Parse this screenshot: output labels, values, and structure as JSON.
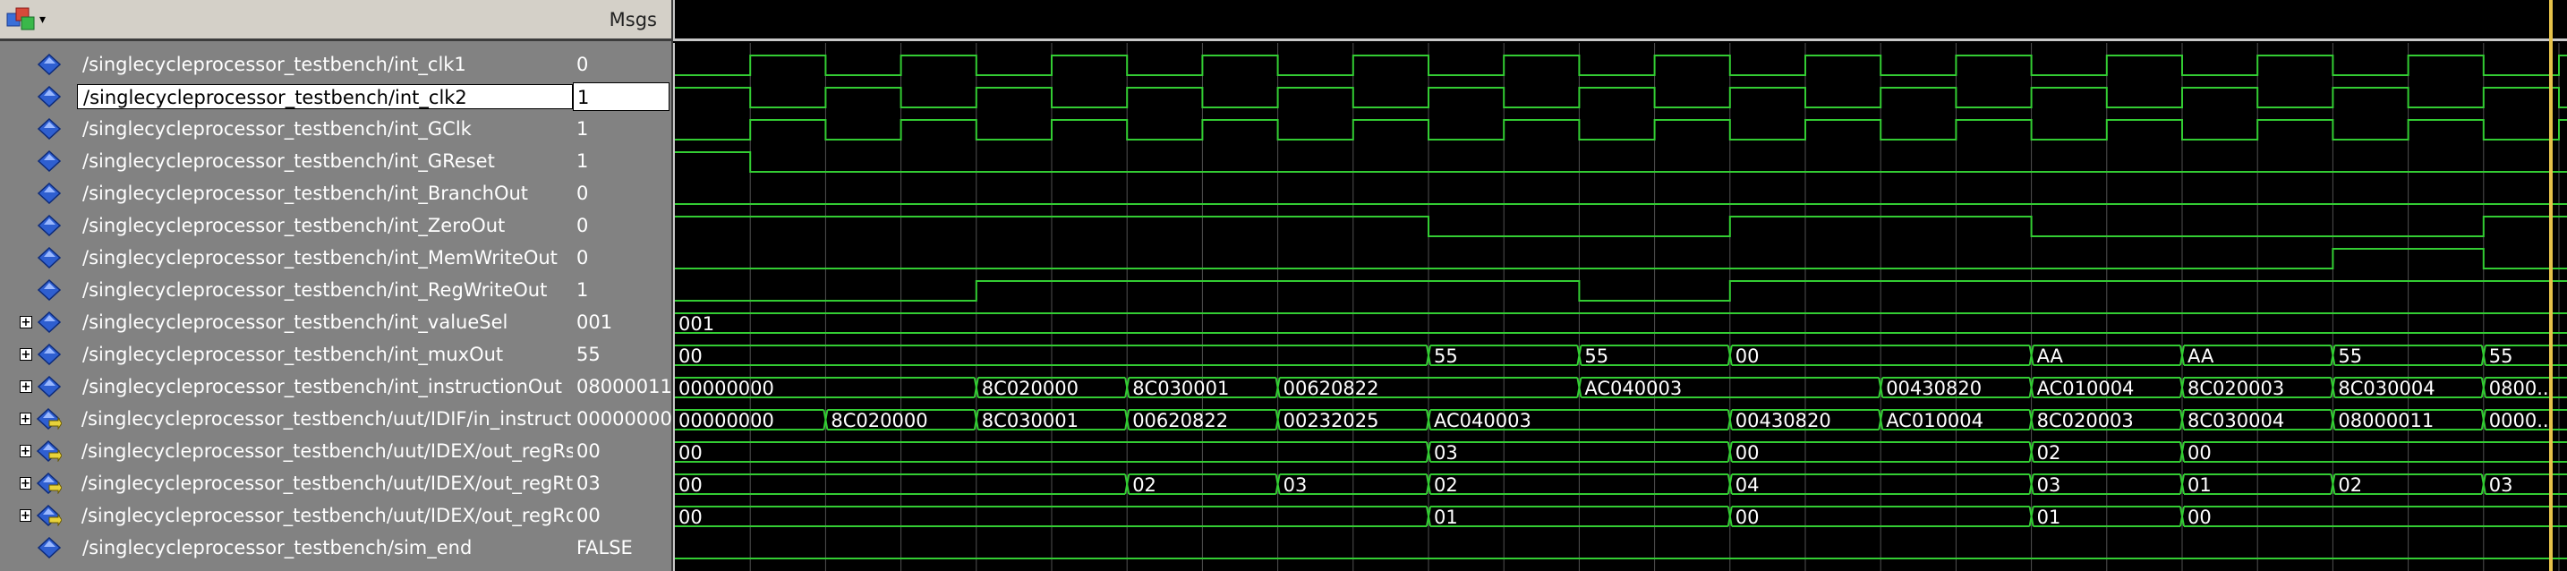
{
  "toolbar": {
    "icon": "wave-tool-icon",
    "dropdown": "▾"
  },
  "header": {
    "msgs_label": "Msgs"
  },
  "colors": {
    "wave": "#33cc33",
    "cursor": "#e6c24a",
    "grid": "#505050",
    "text": "#ffffff"
  },
  "signals": [
    {
      "name": "/singlecycleprocessor_testbench/int_clk1",
      "value": "0",
      "expandable": false,
      "kind": "input"
    },
    {
      "name": "/singlecycleprocessor_testbench/int_clk2",
      "value": "1",
      "expandable": false,
      "kind": "input",
      "selected": true
    },
    {
      "name": "/singlecycleprocessor_testbench/int_GClk",
      "value": "1",
      "expandable": false,
      "kind": "input"
    },
    {
      "name": "/singlecycleprocessor_testbench/int_GReset",
      "value": "1",
      "expandable": false,
      "kind": "input"
    },
    {
      "name": "/singlecycleprocessor_testbench/int_BranchOut",
      "value": "0",
      "expandable": false,
      "kind": "input"
    },
    {
      "name": "/singlecycleprocessor_testbench/int_ZeroOut",
      "value": "0",
      "expandable": false,
      "kind": "input"
    },
    {
      "name": "/singlecycleprocessor_testbench/int_MemWriteOut",
      "value": "0",
      "expandable": false,
      "kind": "input"
    },
    {
      "name": "/singlecycleprocessor_testbench/int_RegWriteOut",
      "value": "1",
      "expandable": false,
      "kind": "input"
    },
    {
      "name": "/singlecycleprocessor_testbench/int_valueSel",
      "value": "001",
      "expandable": true,
      "kind": "input"
    },
    {
      "name": "/singlecycleprocessor_testbench/int_muxOut",
      "value": "55",
      "expandable": true,
      "kind": "input"
    },
    {
      "name": "/singlecycleprocessor_testbench/int_instructionOut",
      "value": "08000011",
      "expandable": true,
      "kind": "input"
    },
    {
      "name": "/singlecycleprocessor_testbench/uut/IDIF/in_instruction",
      "value": "00000000",
      "expandable": true,
      "kind": "port"
    },
    {
      "name": "/singlecycleprocessor_testbench/uut/IDEX/out_regRs",
      "value": "00",
      "expandable": true,
      "kind": "port"
    },
    {
      "name": "/singlecycleprocessor_testbench/uut/IDEX/out_regRt",
      "value": "03",
      "expandable": true,
      "kind": "port"
    },
    {
      "name": "/singlecycleprocessor_testbench/uut/IDEX/out_regRd",
      "value": "00",
      "expandable": true,
      "kind": "port"
    },
    {
      "name": "/singlecycleprocessor_testbench/sim_end",
      "value": "FALSE",
      "expandable": false,
      "kind": "input"
    }
  ],
  "waves": {
    "digital": [
      {
        "levels": [
          0,
          1,
          0,
          1,
          0,
          1,
          0,
          1,
          0,
          1,
          0,
          1,
          0,
          1,
          0,
          1,
          0,
          1,
          0,
          1,
          0,
          1,
          0,
          1,
          0,
          1
        ]
      },
      {
        "levels": [
          1,
          0,
          1,
          0,
          1,
          0,
          1,
          0,
          1,
          0,
          1,
          0,
          1,
          0,
          1,
          0,
          1,
          0,
          1,
          0,
          1,
          0,
          1,
          0,
          1,
          0
        ]
      },
      {
        "levels": [
          0,
          1,
          0,
          1,
          0,
          1,
          0,
          1,
          0,
          1,
          0,
          1,
          0,
          1,
          0,
          1,
          0,
          1,
          0,
          1,
          0,
          1,
          0,
          1,
          0,
          1
        ]
      },
      {
        "levels": [
          1,
          0,
          0,
          0,
          0,
          0,
          0,
          0,
          0,
          0,
          0,
          0,
          0,
          0,
          0,
          0,
          0,
          0,
          0,
          0,
          0,
          0,
          0,
          0,
          0,
          0
        ]
      },
      {
        "levels": [
          0,
          0,
          0,
          0,
          0,
          0,
          0,
          0,
          0,
          0,
          0,
          0,
          0,
          0,
          0,
          0,
          0,
          0,
          0,
          0,
          0,
          0,
          0,
          0,
          0,
          0
        ]
      },
      {
        "levels": [
          1,
          1,
          1,
          1,
          1,
          1,
          1,
          1,
          1,
          1,
          0,
          0,
          0,
          0,
          1,
          1,
          1,
          1,
          0,
          0,
          0,
          0,
          0,
          0,
          1,
          1
        ]
      },
      {
        "levels": [
          0,
          0,
          0,
          0,
          0,
          0,
          0,
          0,
          0,
          0,
          0,
          0,
          0,
          0,
          0,
          0,
          0,
          0,
          0,
          0,
          0,
          0,
          1,
          1,
          0,
          0
        ]
      },
      {
        "levels": [
          0,
          0,
          0,
          0,
          1,
          1,
          1,
          1,
          1,
          1,
          1,
          1,
          0,
          0,
          1,
          1,
          1,
          1,
          1,
          1,
          1,
          1,
          1,
          1,
          1,
          1
        ]
      }
    ],
    "bus": [
      {
        "segments": [
          {
            "start": 0,
            "label": "001"
          }
        ]
      },
      {
        "segments": [
          {
            "start": 0,
            "label": "00"
          },
          {
            "start": 10,
            "label": "55"
          },
          {
            "start": 12,
            "label": "55"
          },
          {
            "start": 14,
            "label": "00"
          },
          {
            "start": 18,
            "label": "AA"
          },
          {
            "start": 20,
            "label": "AA"
          },
          {
            "start": 22,
            "label": "55"
          },
          {
            "start": 24,
            "label": "55"
          }
        ]
      },
      {
        "segments": [
          {
            "start": 0,
            "label": "00000000"
          },
          {
            "start": 4,
            "label": "8C020000"
          },
          {
            "start": 6,
            "label": "8C030001"
          },
          {
            "start": 8,
            "label": "00620822"
          },
          {
            "start": 12,
            "label": "AC040003"
          },
          {
            "start": 16,
            "label": "00430820"
          },
          {
            "start": 18,
            "label": "AC010004"
          },
          {
            "start": 20,
            "label": "8C020003"
          },
          {
            "start": 22,
            "label": "8C030004"
          },
          {
            "start": 24,
            "label": "0800..."
          }
        ]
      },
      {
        "segments": [
          {
            "start": 0,
            "label": "00000000"
          },
          {
            "start": 2,
            "label": "8C020000"
          },
          {
            "start": 4,
            "label": "8C030001"
          },
          {
            "start": 6,
            "label": "00620822"
          },
          {
            "start": 8,
            "label": "00232025"
          },
          {
            "start": 10,
            "label": "AC040003"
          },
          {
            "start": 14,
            "label": "00430820"
          },
          {
            "start": 16,
            "label": "AC010004"
          },
          {
            "start": 18,
            "label": "8C020003"
          },
          {
            "start": 20,
            "label": "8C030004"
          },
          {
            "start": 22,
            "label": "08000011"
          },
          {
            "start": 24,
            "label": "0000..."
          }
        ]
      },
      {
        "segments": [
          {
            "start": 0,
            "label": "00"
          },
          {
            "start": 10,
            "label": "03"
          },
          {
            "start": 14,
            "label": "00"
          },
          {
            "start": 18,
            "label": "02"
          },
          {
            "start": 20,
            "label": "00"
          }
        ]
      },
      {
        "segments": [
          {
            "start": 0,
            "label": "00"
          },
          {
            "start": 6,
            "label": "02"
          },
          {
            "start": 8,
            "label": "03"
          },
          {
            "start": 10,
            "label": "02"
          },
          {
            "start": 14,
            "label": "04"
          },
          {
            "start": 18,
            "label": "03"
          },
          {
            "start": 20,
            "label": "01"
          },
          {
            "start": 22,
            "label": "02"
          },
          {
            "start": 24,
            "label": "03"
          }
        ]
      },
      {
        "segments": [
          {
            "start": 0,
            "label": "00"
          },
          {
            "start": 10,
            "label": "01"
          },
          {
            "start": 14,
            "label": "00"
          },
          {
            "start": 18,
            "label": "01"
          },
          {
            "start": 20,
            "label": "00"
          }
        ]
      }
    ]
  }
}
